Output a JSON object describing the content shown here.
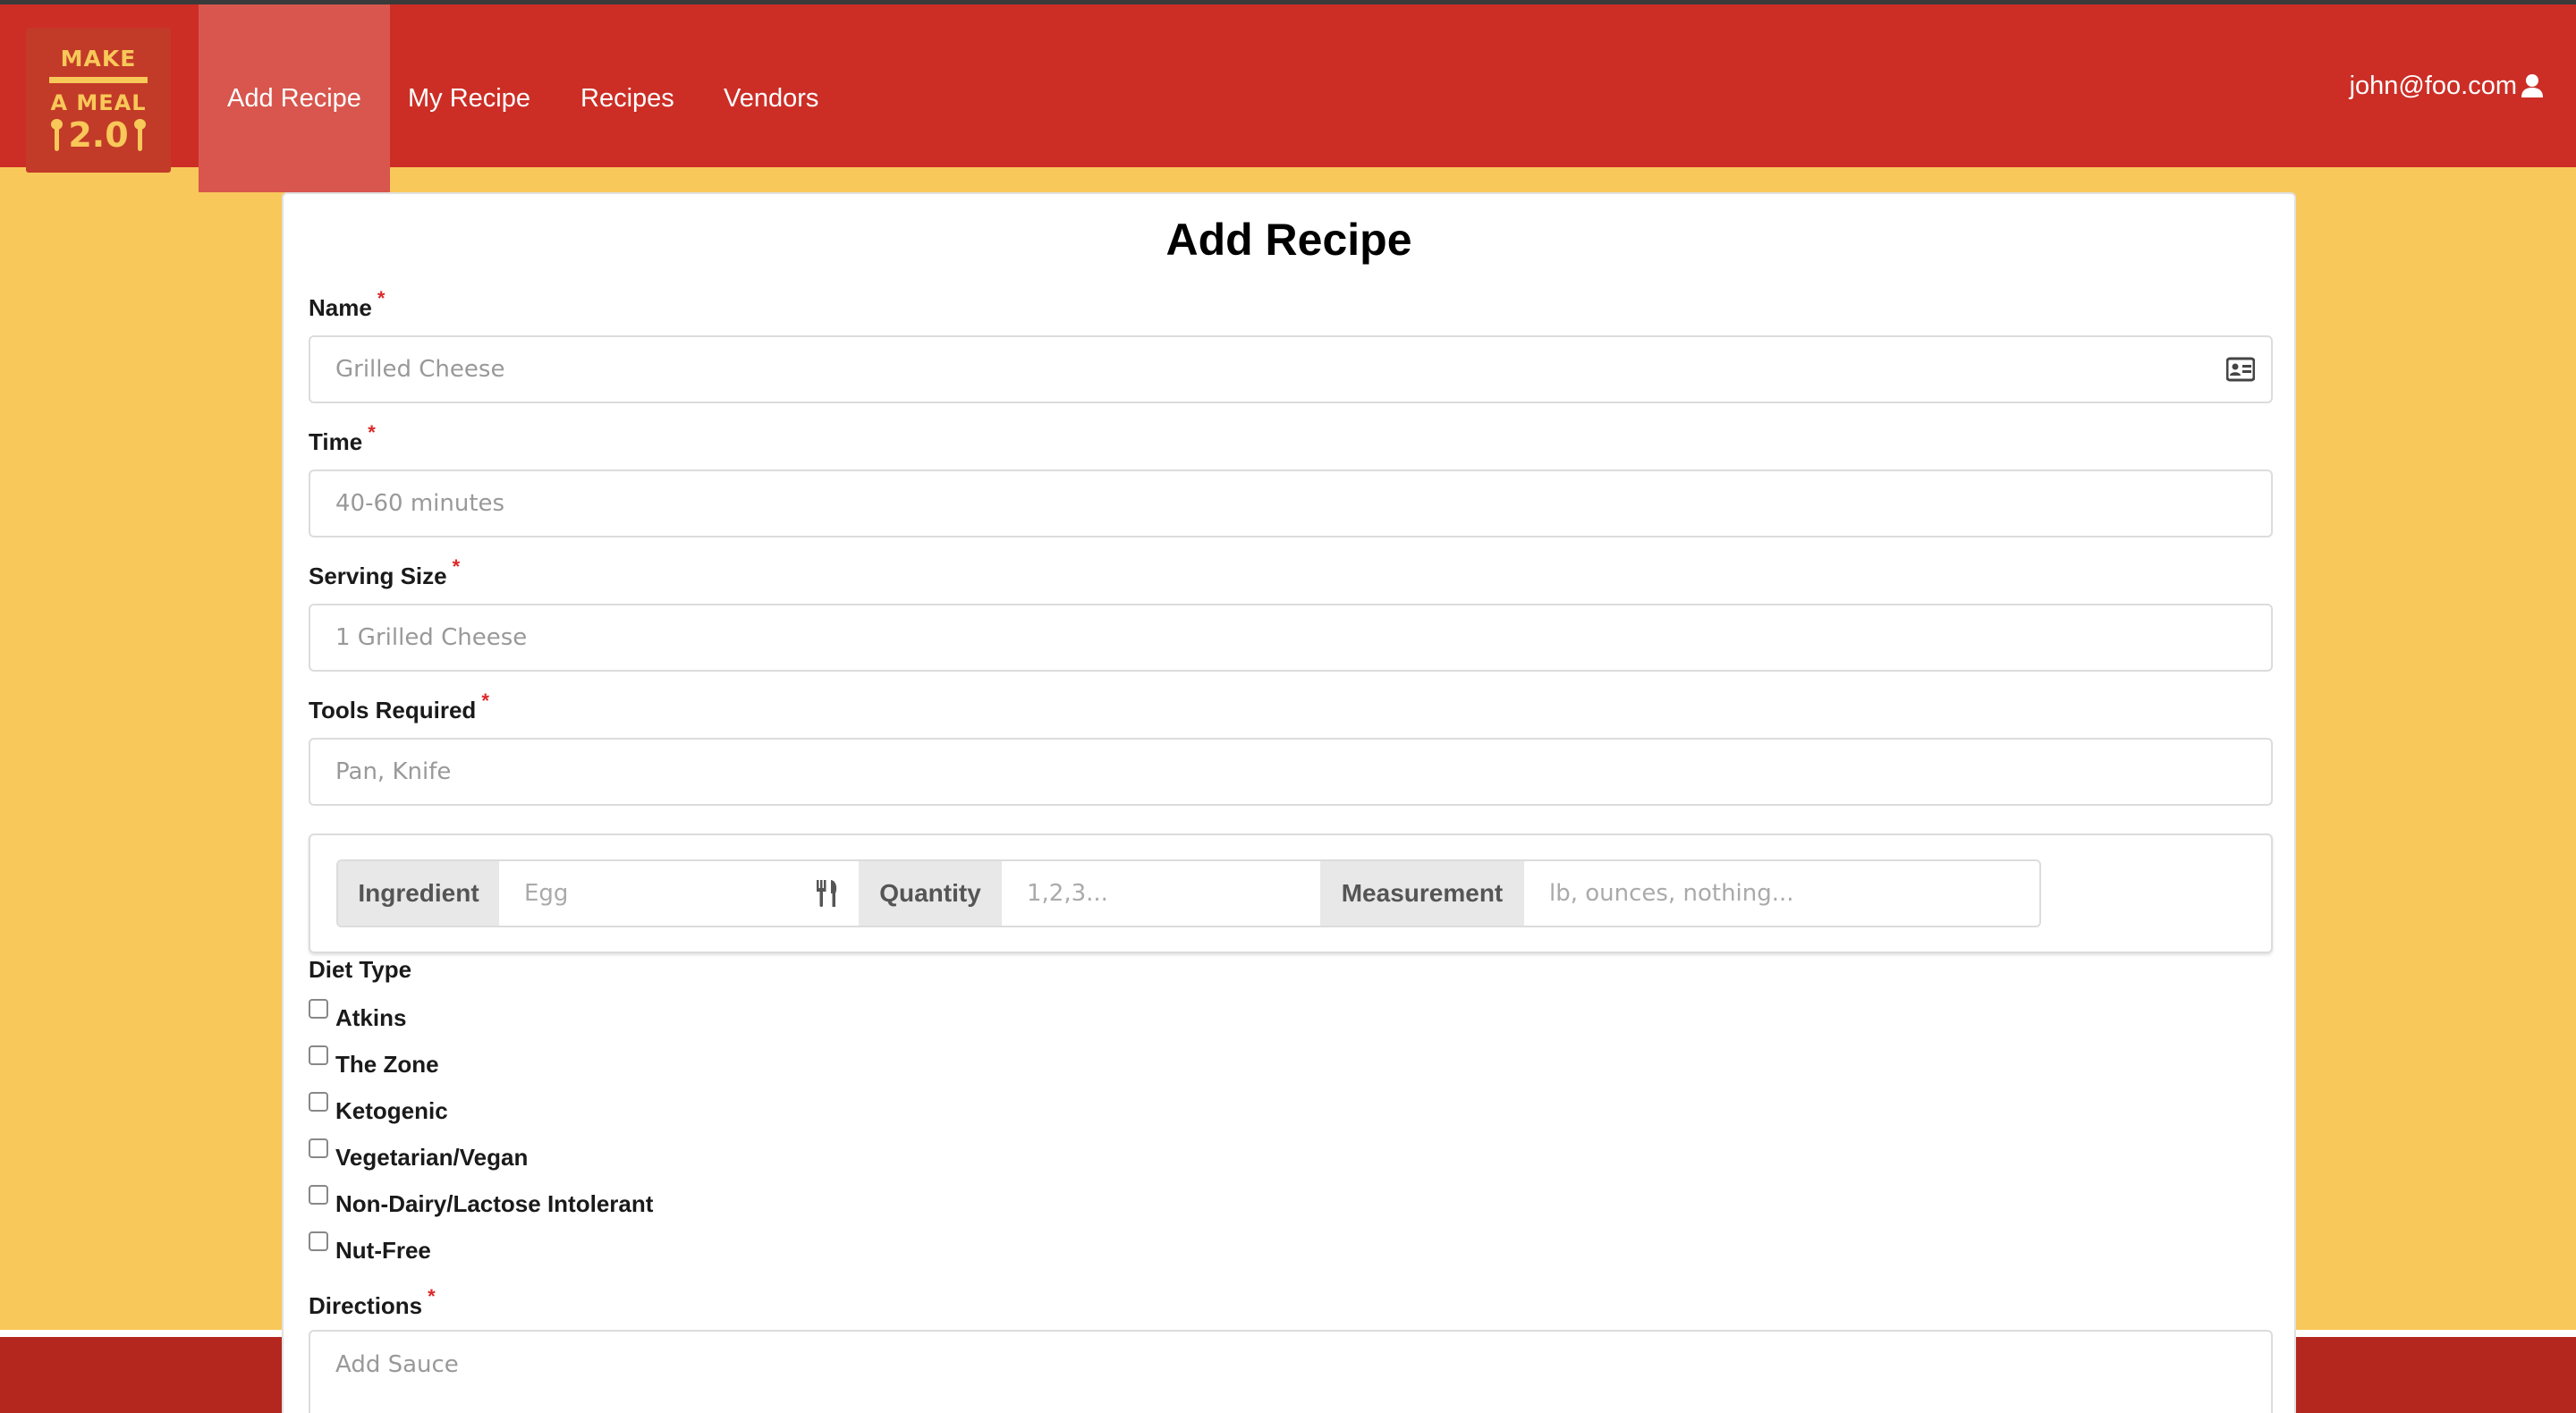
{
  "logo": {
    "line1": "MAKE",
    "line2": "A MEAL",
    "line3": "2.0"
  },
  "nav": {
    "items": [
      {
        "label": "Add Recipe",
        "active": true
      },
      {
        "label": "My Recipe",
        "active": false
      },
      {
        "label": "Recipes",
        "active": false
      },
      {
        "label": "Vendors",
        "active": false
      }
    ],
    "user_email": "john@foo.com"
  },
  "form": {
    "title": "Add Recipe",
    "required_mark": "*",
    "name": {
      "label": "Name",
      "placeholder": "Grilled Cheese"
    },
    "time": {
      "label": "Time",
      "placeholder": "40-60 minutes"
    },
    "serving_size": {
      "label": "Serving Size",
      "placeholder": "1 Grilled Cheese"
    },
    "tools": {
      "label": "Tools Required",
      "placeholder": "Pan, Knife"
    },
    "ingredient": {
      "ingredient_label": "Ingredient",
      "ingredient_placeholder": "Egg",
      "quantity_label": "Quantity",
      "quantity_placeholder": "1,2,3...",
      "measurement_label": "Measurement",
      "measurement_placeholder": "lb, ounces, nothing..."
    },
    "diet": {
      "label": "Diet Type",
      "options": [
        "Atkins",
        "The Zone",
        "Ketogenic",
        "Vegetarian/Vegan",
        "Non-Dairy/Lactose Intolerant",
        "Nut-Free"
      ]
    },
    "directions": {
      "label": "Directions",
      "placeholder": "Add Sauce"
    }
  },
  "colors": {
    "navbar": "#cc2e26",
    "background": "#f9c85a",
    "logo_text": "#f8c859",
    "required": "#db2828"
  },
  "icons": {
    "name_field": "id-card-icon",
    "ingredient_field": "utensils-icon",
    "user": "user-icon"
  }
}
